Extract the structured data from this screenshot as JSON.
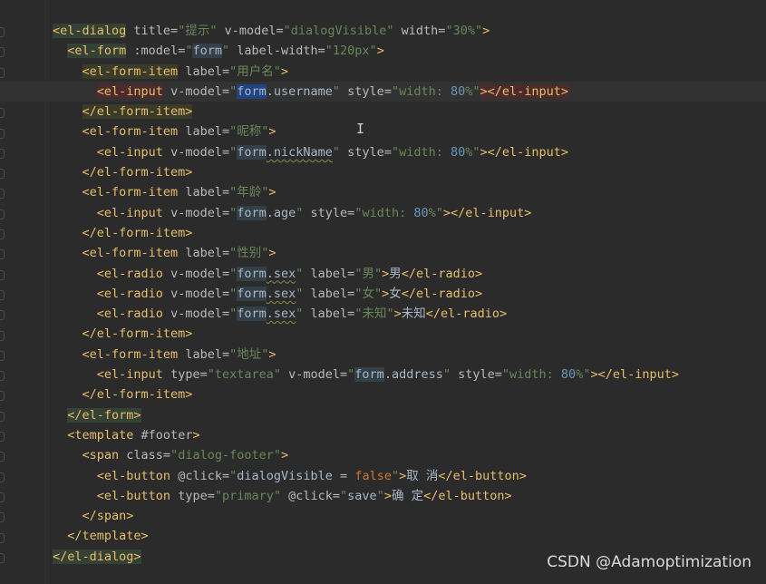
{
  "editor": {
    "cursor_glyph": "I",
    "bulb_icon": "lightbulb-icon",
    "lines": [
      [
        {
          "c": "tag hl-tag-green",
          "t": "<el-dialog"
        },
        {
          "c": "attr",
          "t": " title="
        },
        {
          "c": "str",
          "t": "\"提示\""
        },
        {
          "c": "attr",
          "t": " v-model="
        },
        {
          "c": "str",
          "t": "\"dialogVisible\""
        },
        {
          "c": "attr",
          "t": " width="
        },
        {
          "c": "str",
          "t": "\"30%\""
        },
        {
          "c": "tag",
          "t": ">"
        }
      ],
      [
        {
          "c": "txt",
          "t": "  "
        },
        {
          "c": "tag hl-tag-green",
          "t": "<el-form"
        },
        {
          "c": "attr",
          "t": " :model="
        },
        {
          "c": "str",
          "t": "\""
        },
        {
          "c": "txt ref",
          "t": "form"
        },
        {
          "c": "str",
          "t": "\""
        },
        {
          "c": "attr",
          "t": " label-width="
        },
        {
          "c": "str",
          "t": "\"120px\""
        },
        {
          "c": "tag",
          "t": ">"
        }
      ],
      [
        {
          "c": "txt",
          "t": "    "
        },
        {
          "c": "tag hl-tag-olive",
          "t": "<el-form-item"
        },
        {
          "c": "attr",
          "t": " label="
        },
        {
          "c": "str",
          "t": "\"用户名\""
        },
        {
          "c": "tag",
          "t": ">"
        }
      ],
      [
        {
          "c": "txt",
          "t": "      "
        },
        {
          "c": "tag hl-tag-red",
          "t": "<el-input"
        },
        {
          "c": "attr",
          "t": " v-model="
        },
        {
          "c": "str",
          "t": "\""
        },
        {
          "c": "txt ref-sel",
          "t": "form"
        },
        {
          "c": "txt",
          "t": ".username"
        },
        {
          "c": "str",
          "t": "\""
        },
        {
          "c": "attr",
          "t": " style="
        },
        {
          "c": "str",
          "t": "\"width: "
        },
        {
          "c": "num",
          "t": "80"
        },
        {
          "c": "str",
          "t": "%\""
        },
        {
          "c": "tag hl-tag-red",
          "t": "></el-input>"
        }
      ],
      [
        {
          "c": "txt",
          "t": "    "
        },
        {
          "c": "tag hl-tag-olive",
          "t": "</el-form-item>"
        }
      ],
      [
        {
          "c": "txt",
          "t": "    "
        },
        {
          "c": "tag",
          "t": "<el-form-item"
        },
        {
          "c": "attr",
          "t": " label="
        },
        {
          "c": "str",
          "t": "\"昵称\""
        },
        {
          "c": "tag",
          "t": ">"
        }
      ],
      [
        {
          "c": "txt",
          "t": "      "
        },
        {
          "c": "tag",
          "t": "<el-input"
        },
        {
          "c": "attr",
          "t": " v-model="
        },
        {
          "c": "str",
          "t": "\""
        },
        {
          "c": "txt ref",
          "t": "form"
        },
        {
          "c": "txt squig",
          "t": ".nickName"
        },
        {
          "c": "str",
          "t": "\""
        },
        {
          "c": "attr",
          "t": " style="
        },
        {
          "c": "str",
          "t": "\"width: "
        },
        {
          "c": "num",
          "t": "80"
        },
        {
          "c": "str",
          "t": "%\""
        },
        {
          "c": "tag",
          "t": "></el-input>"
        }
      ],
      [
        {
          "c": "txt",
          "t": "    "
        },
        {
          "c": "tag",
          "t": "</el-form-item>"
        }
      ],
      [
        {
          "c": "txt",
          "t": "    "
        },
        {
          "c": "tag",
          "t": "<el-form-item"
        },
        {
          "c": "attr",
          "t": " label="
        },
        {
          "c": "str",
          "t": "\"年龄\""
        },
        {
          "c": "tag",
          "t": ">"
        }
      ],
      [
        {
          "c": "txt",
          "t": "      "
        },
        {
          "c": "tag",
          "t": "<el-input"
        },
        {
          "c": "attr",
          "t": " v-model="
        },
        {
          "c": "str",
          "t": "\""
        },
        {
          "c": "txt ref",
          "t": "form"
        },
        {
          "c": "txt",
          "t": ".age"
        },
        {
          "c": "str",
          "t": "\""
        },
        {
          "c": "attr",
          "t": " style="
        },
        {
          "c": "str",
          "t": "\"width: "
        },
        {
          "c": "num",
          "t": "80"
        },
        {
          "c": "str",
          "t": "%\""
        },
        {
          "c": "tag",
          "t": "></el-input>"
        }
      ],
      [
        {
          "c": "txt",
          "t": "    "
        },
        {
          "c": "tag",
          "t": "</el-form-item>"
        }
      ],
      [
        {
          "c": "txt",
          "t": "    "
        },
        {
          "c": "tag",
          "t": "<el-form-item"
        },
        {
          "c": "attr",
          "t": " label="
        },
        {
          "c": "str",
          "t": "\"性别\""
        },
        {
          "c": "tag",
          "t": ">"
        }
      ],
      [
        {
          "c": "txt",
          "t": "      "
        },
        {
          "c": "tag",
          "t": "<el-radio"
        },
        {
          "c": "attr",
          "t": " v-model="
        },
        {
          "c": "str",
          "t": "\""
        },
        {
          "c": "txt ref",
          "t": "form"
        },
        {
          "c": "txt squig",
          "t": ".sex"
        },
        {
          "c": "str",
          "t": "\""
        },
        {
          "c": "attr",
          "t": " label="
        },
        {
          "c": "str",
          "t": "\"男\""
        },
        {
          "c": "tag",
          "t": ">"
        },
        {
          "c": "txt",
          "t": "男"
        },
        {
          "c": "tag",
          "t": "</el-radio>"
        }
      ],
      [
        {
          "c": "txt",
          "t": "      "
        },
        {
          "c": "tag",
          "t": "<el-radio"
        },
        {
          "c": "attr",
          "t": " v-model="
        },
        {
          "c": "str",
          "t": "\""
        },
        {
          "c": "txt ref",
          "t": "form"
        },
        {
          "c": "txt squig",
          "t": ".sex"
        },
        {
          "c": "str",
          "t": "\""
        },
        {
          "c": "attr",
          "t": " label="
        },
        {
          "c": "str",
          "t": "\"女\""
        },
        {
          "c": "tag",
          "t": ">"
        },
        {
          "c": "txt",
          "t": "女"
        },
        {
          "c": "tag",
          "t": "</el-radio>"
        }
      ],
      [
        {
          "c": "txt",
          "t": "      "
        },
        {
          "c": "tag",
          "t": "<el-radio"
        },
        {
          "c": "attr",
          "t": " v-model="
        },
        {
          "c": "str",
          "t": "\""
        },
        {
          "c": "txt ref",
          "t": "form"
        },
        {
          "c": "txt squig",
          "t": ".sex"
        },
        {
          "c": "str",
          "t": "\""
        },
        {
          "c": "attr",
          "t": " label="
        },
        {
          "c": "str",
          "t": "\"未知\""
        },
        {
          "c": "tag",
          "t": ">"
        },
        {
          "c": "txt",
          "t": "未知"
        },
        {
          "c": "tag",
          "t": "</el-radio>"
        }
      ],
      [
        {
          "c": "txt",
          "t": "    "
        },
        {
          "c": "tag",
          "t": "</el-form-item>"
        }
      ],
      [
        {
          "c": "txt",
          "t": "    "
        },
        {
          "c": "tag",
          "t": "<el-form-item"
        },
        {
          "c": "attr",
          "t": " label="
        },
        {
          "c": "str",
          "t": "\"地址\""
        },
        {
          "c": "tag",
          "t": ">"
        }
      ],
      [
        {
          "c": "txt",
          "t": "      "
        },
        {
          "c": "tag",
          "t": "<el-input"
        },
        {
          "c": "attr",
          "t": " type="
        },
        {
          "c": "str",
          "t": "\"textarea\""
        },
        {
          "c": "attr",
          "t": " v-model="
        },
        {
          "c": "str",
          "t": "\""
        },
        {
          "c": "txt ref",
          "t": "form"
        },
        {
          "c": "txt",
          "t": ".address"
        },
        {
          "c": "str",
          "t": "\""
        },
        {
          "c": "attr",
          "t": " style="
        },
        {
          "c": "str",
          "t": "\"width: "
        },
        {
          "c": "num",
          "t": "80"
        },
        {
          "c": "str",
          "t": "%\""
        },
        {
          "c": "tag",
          "t": "></el-input>"
        }
      ],
      [
        {
          "c": "txt",
          "t": "    "
        },
        {
          "c": "tag",
          "t": "</el-form-item>"
        }
      ],
      [
        {
          "c": "txt",
          "t": "  "
        },
        {
          "c": "tag hl-tag-green",
          "t": "</el-form>"
        }
      ],
      [
        {
          "c": "txt",
          "t": "  "
        },
        {
          "c": "tag",
          "t": "<template"
        },
        {
          "c": "attr",
          "t": " #footer"
        },
        {
          "c": "tag",
          "t": ">"
        }
      ],
      [
        {
          "c": "txt",
          "t": "    "
        },
        {
          "c": "tag",
          "t": "<span"
        },
        {
          "c": "attr",
          "t": " class="
        },
        {
          "c": "str",
          "t": "\"dialog-footer\""
        },
        {
          "c": "tag",
          "t": ">"
        }
      ],
      [
        {
          "c": "txt",
          "t": "      "
        },
        {
          "c": "tag",
          "t": "<el-button"
        },
        {
          "c": "attr",
          "t": " @click="
        },
        {
          "c": "str",
          "t": "\""
        },
        {
          "c": "txt",
          "t": "dialogVisible "
        },
        {
          "c": "eq",
          "t": "="
        },
        {
          "c": "txt",
          "t": " "
        },
        {
          "c": "kw",
          "t": "false"
        },
        {
          "c": "str",
          "t": "\""
        },
        {
          "c": "tag",
          "t": ">"
        },
        {
          "c": "txt",
          "t": "取 消"
        },
        {
          "c": "tag",
          "t": "</el-button>"
        }
      ],
      [
        {
          "c": "txt",
          "t": "      "
        },
        {
          "c": "tag",
          "t": "<el-button"
        },
        {
          "c": "attr",
          "t": " type="
        },
        {
          "c": "str",
          "t": "\"primary\""
        },
        {
          "c": "attr",
          "t": " @click="
        },
        {
          "c": "str",
          "t": "\""
        },
        {
          "c": "txt",
          "t": "save"
        },
        {
          "c": "str",
          "t": "\""
        },
        {
          "c": "tag",
          "t": ">"
        },
        {
          "c": "txt",
          "t": "确 定"
        },
        {
          "c": "tag",
          "t": "</el-button>"
        }
      ],
      [
        {
          "c": "txt",
          "t": "    "
        },
        {
          "c": "tag",
          "t": "</span>"
        }
      ],
      [
        {
          "c": "txt",
          "t": "  "
        },
        {
          "c": "tag",
          "t": "</template>"
        }
      ],
      [
        {
          "c": "tag hl-tag-green",
          "t": "</el-dialog>"
        }
      ]
    ]
  },
  "watermark": "CSDN @Adamoptimization"
}
